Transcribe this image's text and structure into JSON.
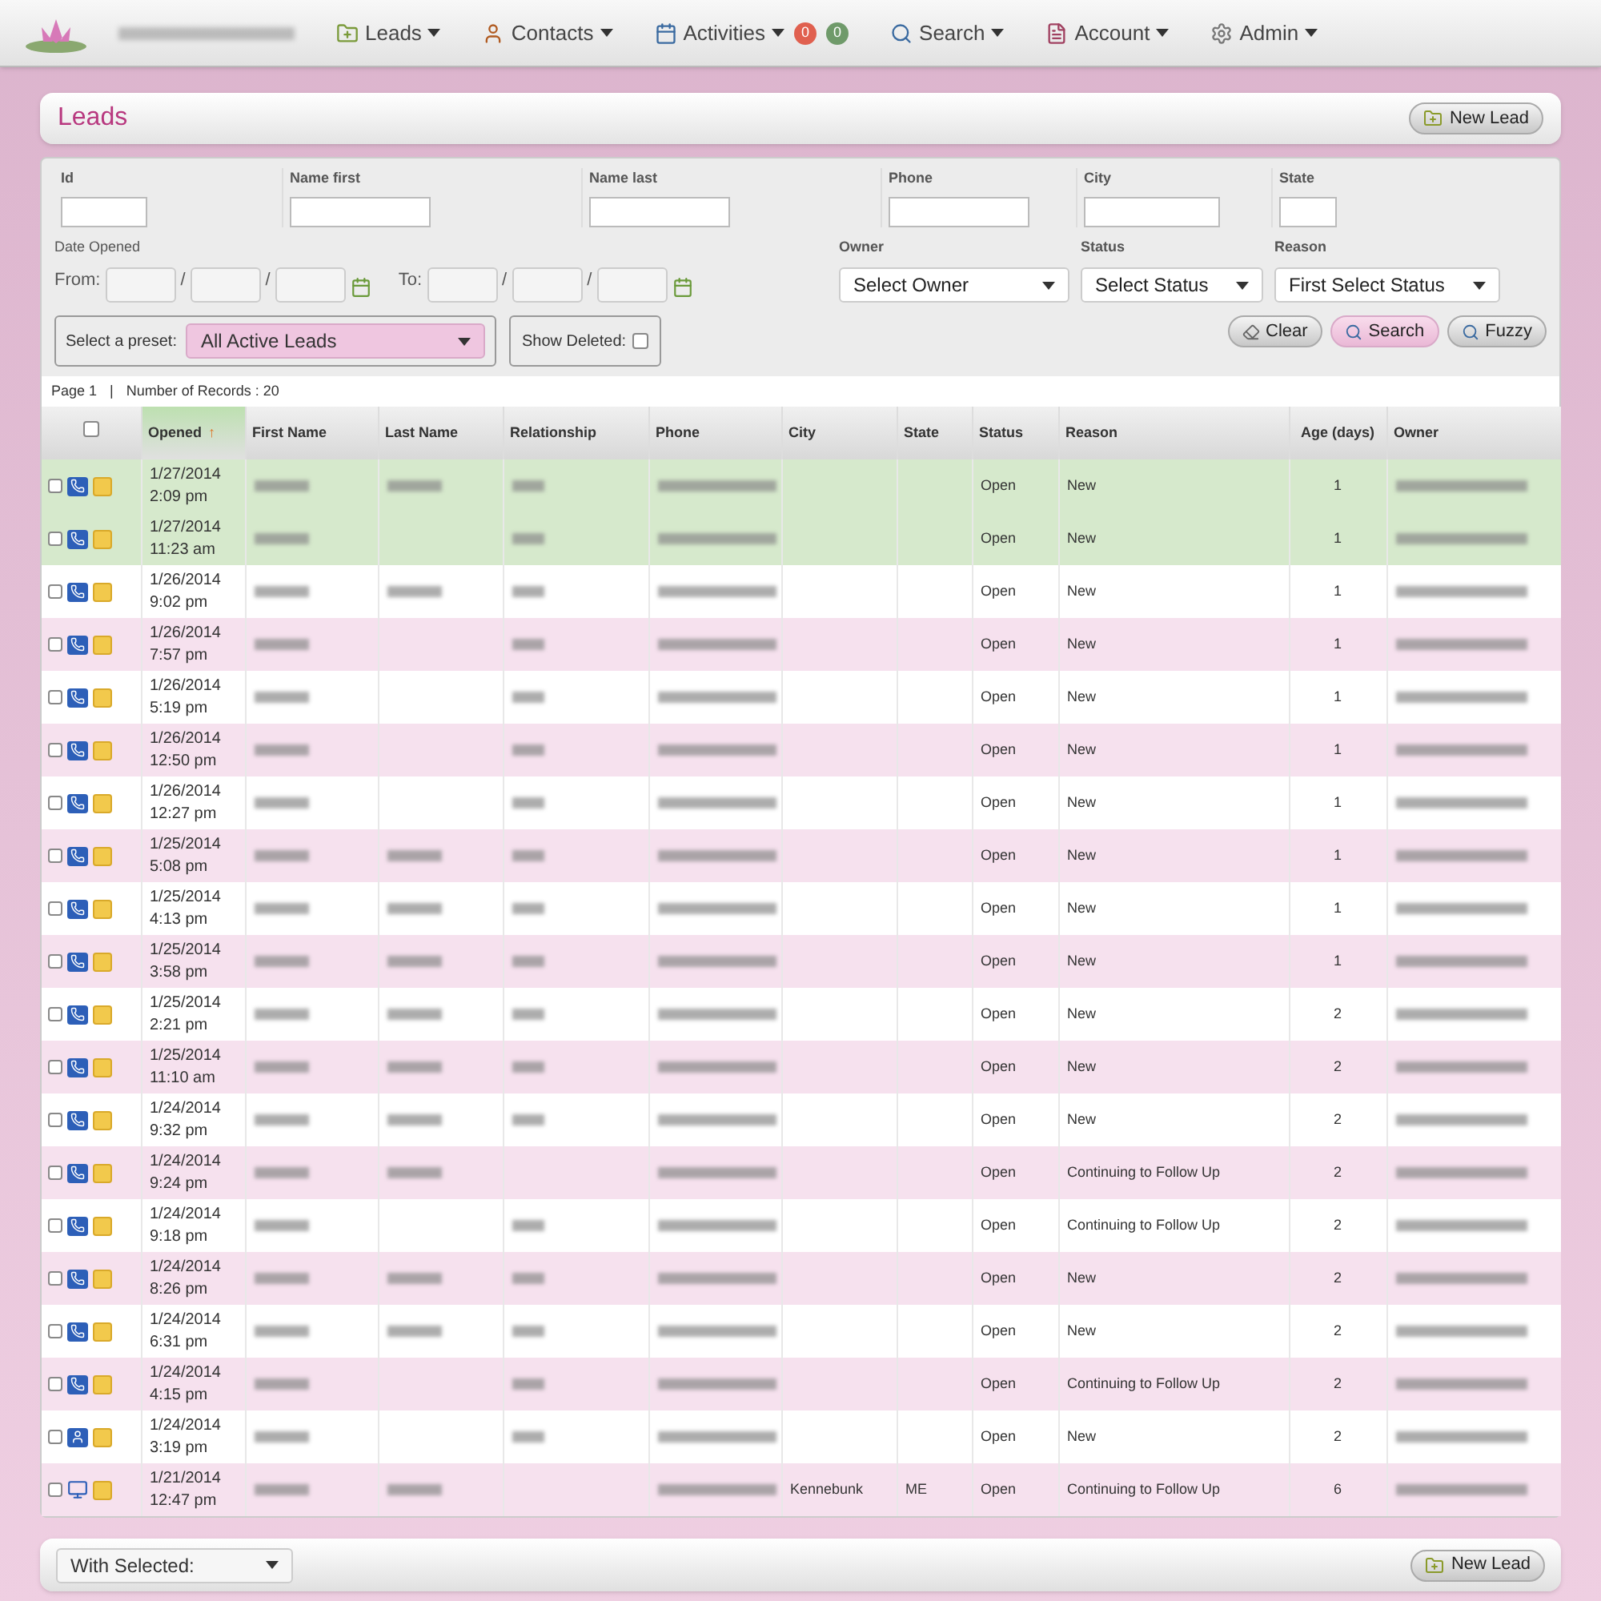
{
  "nav": {
    "items": [
      {
        "label": "Leads"
      },
      {
        "label": "Contacts"
      },
      {
        "label": "Activities",
        "badges": [
          {
            "text": "0",
            "color": "#e0604f"
          },
          {
            "text": "0",
            "color": "#6f9a6a"
          }
        ]
      },
      {
        "label": "Search"
      },
      {
        "label": "Account"
      },
      {
        "label": "Admin"
      }
    ]
  },
  "header": {
    "title": "Leads",
    "new_button": "New Lead"
  },
  "filters": {
    "fields": [
      {
        "label": "Id"
      },
      {
        "label": "Name first"
      },
      {
        "label": "Name last"
      },
      {
        "label": "Phone"
      },
      {
        "label": "City"
      },
      {
        "label": "State"
      }
    ],
    "date_label": "Date Opened",
    "from_label": "From:",
    "to_label": "To:",
    "separator": "/",
    "selects": [
      {
        "label": "Owner",
        "value": "Select Owner"
      },
      {
        "label": "Status",
        "value": "Select Status"
      },
      {
        "label": "Reason",
        "value": "First Select Status"
      }
    ],
    "preset_label": "Select a preset:",
    "preset_value": "All Active Leads",
    "show_deleted_label": "Show Deleted:",
    "show_deleted": false,
    "buttons": [
      {
        "label": "Clear",
        "selected": false
      },
      {
        "label": "Search",
        "selected": true
      },
      {
        "label": "Fuzzy",
        "selected": false
      }
    ]
  },
  "pager": {
    "page": "Page 1",
    "divider": "|",
    "records": "Number of Records : 20"
  },
  "table": {
    "select_all_checked": false,
    "columns": [
      {
        "label": "Opened",
        "sorted": true
      },
      {
        "label": "First Name",
        "sorted": false
      },
      {
        "label": "Last Name",
        "sorted": false
      },
      {
        "label": "Relationship",
        "sorted": false
      },
      {
        "label": "Phone",
        "sorted": false
      },
      {
        "label": "City",
        "sorted": false
      },
      {
        "label": "State",
        "sorted": false
      },
      {
        "label": "Status",
        "sorted": false
      },
      {
        "label": "Reason",
        "sorted": false
      },
      {
        "label": "Age (days)",
        "sorted": false
      },
      {
        "label": "Owner",
        "sorted": false
      }
    ],
    "sort_arrow": "↑",
    "rows": [
      {
        "highlighted": true,
        "checked": false,
        "kind": "phone",
        "cells": [
          {
            "kind": "datetime",
            "date": "1/27/2014",
            "time": "2:09 pm"
          },
          {
            "kind": "blurred"
          },
          {
            "kind": "blurred"
          },
          {
            "kind": "blurred"
          },
          {
            "kind": "blurred"
          },
          {
            "kind": "blank"
          },
          {
            "kind": "blank"
          },
          {
            "kind": "text",
            "text": "Open"
          },
          {
            "kind": "text",
            "text": "New"
          },
          {
            "kind": "text",
            "text": "1"
          },
          {
            "kind": "blurred"
          }
        ]
      },
      {
        "highlighted": true,
        "checked": false,
        "kind": "phone",
        "cells": [
          {
            "kind": "datetime",
            "date": "1/27/2014",
            "time": "11:23 am"
          },
          {
            "kind": "blurred"
          },
          {
            "kind": "blank"
          },
          {
            "kind": "blurred"
          },
          {
            "kind": "blurred"
          },
          {
            "kind": "blank"
          },
          {
            "kind": "blank"
          },
          {
            "kind": "text",
            "text": "Open"
          },
          {
            "kind": "text",
            "text": "New"
          },
          {
            "kind": "text",
            "text": "1"
          },
          {
            "kind": "blurred"
          }
        ]
      },
      {
        "highlighted": false,
        "checked": false,
        "kind": "phone",
        "cells": [
          {
            "kind": "datetime",
            "date": "1/26/2014",
            "time": "9:02 pm"
          },
          {
            "kind": "blurred"
          },
          {
            "kind": "blurred"
          },
          {
            "kind": "blurred"
          },
          {
            "kind": "blurred"
          },
          {
            "kind": "blank"
          },
          {
            "kind": "blank"
          },
          {
            "kind": "text",
            "text": "Open"
          },
          {
            "kind": "text",
            "text": "New"
          },
          {
            "kind": "text",
            "text": "1"
          },
          {
            "kind": "blurred"
          }
        ]
      },
      {
        "highlighted": false,
        "checked": false,
        "kind": "phone",
        "cells": [
          {
            "kind": "datetime",
            "date": "1/26/2014",
            "time": "7:57 pm"
          },
          {
            "kind": "blurred"
          },
          {
            "kind": "blank"
          },
          {
            "kind": "blurred"
          },
          {
            "kind": "blurred"
          },
          {
            "kind": "blank"
          },
          {
            "kind": "blank"
          },
          {
            "kind": "text",
            "text": "Open"
          },
          {
            "kind": "text",
            "text": "New"
          },
          {
            "kind": "text",
            "text": "1"
          },
          {
            "kind": "blurred"
          }
        ]
      },
      {
        "highlighted": false,
        "checked": false,
        "kind": "phone",
        "cells": [
          {
            "kind": "datetime",
            "date": "1/26/2014",
            "time": "5:19 pm"
          },
          {
            "kind": "blurred"
          },
          {
            "kind": "blank"
          },
          {
            "kind": "blurred"
          },
          {
            "kind": "blurred"
          },
          {
            "kind": "blank"
          },
          {
            "kind": "blank"
          },
          {
            "kind": "text",
            "text": "Open"
          },
          {
            "kind": "text",
            "text": "New"
          },
          {
            "kind": "text",
            "text": "1"
          },
          {
            "kind": "blurred"
          }
        ]
      },
      {
        "highlighted": false,
        "checked": false,
        "kind": "phone",
        "cells": [
          {
            "kind": "datetime",
            "date": "1/26/2014",
            "time": "12:50 pm"
          },
          {
            "kind": "blurred"
          },
          {
            "kind": "blank"
          },
          {
            "kind": "blurred"
          },
          {
            "kind": "blurred"
          },
          {
            "kind": "blank"
          },
          {
            "kind": "blank"
          },
          {
            "kind": "text",
            "text": "Open"
          },
          {
            "kind": "text",
            "text": "New"
          },
          {
            "kind": "text",
            "text": "1"
          },
          {
            "kind": "blurred"
          }
        ]
      },
      {
        "highlighted": false,
        "checked": false,
        "kind": "phone",
        "cells": [
          {
            "kind": "datetime",
            "date": "1/26/2014",
            "time": "12:27 pm"
          },
          {
            "kind": "blurred"
          },
          {
            "kind": "blank"
          },
          {
            "kind": "blurred"
          },
          {
            "kind": "blurred"
          },
          {
            "kind": "blank"
          },
          {
            "kind": "blank"
          },
          {
            "kind": "text",
            "text": "Open"
          },
          {
            "kind": "text",
            "text": "New"
          },
          {
            "kind": "text",
            "text": "1"
          },
          {
            "kind": "blurred"
          }
        ]
      },
      {
        "highlighted": false,
        "checked": false,
        "kind": "phone",
        "cells": [
          {
            "kind": "datetime",
            "date": "1/25/2014",
            "time": "5:08 pm"
          },
          {
            "kind": "blurred"
          },
          {
            "kind": "blurred"
          },
          {
            "kind": "blurred"
          },
          {
            "kind": "blurred"
          },
          {
            "kind": "blank"
          },
          {
            "kind": "blank"
          },
          {
            "kind": "text",
            "text": "Open"
          },
          {
            "kind": "text",
            "text": "New"
          },
          {
            "kind": "text",
            "text": "1"
          },
          {
            "kind": "blurred"
          }
        ]
      },
      {
        "highlighted": false,
        "checked": false,
        "kind": "phone",
        "cells": [
          {
            "kind": "datetime",
            "date": "1/25/2014",
            "time": "4:13 pm"
          },
          {
            "kind": "blurred"
          },
          {
            "kind": "blurred"
          },
          {
            "kind": "blurred"
          },
          {
            "kind": "blurred"
          },
          {
            "kind": "blank"
          },
          {
            "kind": "blank"
          },
          {
            "kind": "text",
            "text": "Open"
          },
          {
            "kind": "text",
            "text": "New"
          },
          {
            "kind": "text",
            "text": "1"
          },
          {
            "kind": "blurred"
          }
        ]
      },
      {
        "highlighted": false,
        "checked": false,
        "kind": "phone",
        "cells": [
          {
            "kind": "datetime",
            "date": "1/25/2014",
            "time": "3:58 pm"
          },
          {
            "kind": "blurred"
          },
          {
            "kind": "blurred"
          },
          {
            "kind": "blurred"
          },
          {
            "kind": "blurred"
          },
          {
            "kind": "blank"
          },
          {
            "kind": "blank"
          },
          {
            "kind": "text",
            "text": "Open"
          },
          {
            "kind": "text",
            "text": "New"
          },
          {
            "kind": "text",
            "text": "1"
          },
          {
            "kind": "blurred"
          }
        ]
      },
      {
        "highlighted": false,
        "checked": false,
        "kind": "phone",
        "cells": [
          {
            "kind": "datetime",
            "date": "1/25/2014",
            "time": "2:21 pm"
          },
          {
            "kind": "blurred"
          },
          {
            "kind": "blurred"
          },
          {
            "kind": "blurred"
          },
          {
            "kind": "blurred"
          },
          {
            "kind": "blank"
          },
          {
            "kind": "blank"
          },
          {
            "kind": "text",
            "text": "Open"
          },
          {
            "kind": "text",
            "text": "New"
          },
          {
            "kind": "text",
            "text": "2"
          },
          {
            "kind": "blurred"
          }
        ]
      },
      {
        "highlighted": false,
        "checked": false,
        "kind": "phone",
        "cells": [
          {
            "kind": "datetime",
            "date": "1/25/2014",
            "time": "11:10 am"
          },
          {
            "kind": "blurred"
          },
          {
            "kind": "blurred"
          },
          {
            "kind": "blurred"
          },
          {
            "kind": "blurred"
          },
          {
            "kind": "blank"
          },
          {
            "kind": "blank"
          },
          {
            "kind": "text",
            "text": "Open"
          },
          {
            "kind": "text",
            "text": "New"
          },
          {
            "kind": "text",
            "text": "2"
          },
          {
            "kind": "blurred"
          }
        ]
      },
      {
        "highlighted": false,
        "checked": false,
        "kind": "phone",
        "cells": [
          {
            "kind": "datetime",
            "date": "1/24/2014",
            "time": "9:32 pm"
          },
          {
            "kind": "blurred"
          },
          {
            "kind": "blurred"
          },
          {
            "kind": "blurred"
          },
          {
            "kind": "blurred"
          },
          {
            "kind": "blank"
          },
          {
            "kind": "blank"
          },
          {
            "kind": "text",
            "text": "Open"
          },
          {
            "kind": "text",
            "text": "New"
          },
          {
            "kind": "text",
            "text": "2"
          },
          {
            "kind": "blurred"
          }
        ]
      },
      {
        "highlighted": false,
        "checked": false,
        "kind": "phone",
        "cells": [
          {
            "kind": "datetime",
            "date": "1/24/2014",
            "time": "9:24 pm"
          },
          {
            "kind": "blurred"
          },
          {
            "kind": "blurred"
          },
          {
            "kind": "blank"
          },
          {
            "kind": "blurred"
          },
          {
            "kind": "blank"
          },
          {
            "kind": "blank"
          },
          {
            "kind": "text",
            "text": "Open"
          },
          {
            "kind": "text",
            "text": "Continuing to Follow Up"
          },
          {
            "kind": "text",
            "text": "2"
          },
          {
            "kind": "blurred"
          }
        ]
      },
      {
        "highlighted": false,
        "checked": false,
        "kind": "phone",
        "cells": [
          {
            "kind": "datetime",
            "date": "1/24/2014",
            "time": "9:18 pm"
          },
          {
            "kind": "blurred"
          },
          {
            "kind": "blank"
          },
          {
            "kind": "blurred"
          },
          {
            "kind": "blurred"
          },
          {
            "kind": "blank"
          },
          {
            "kind": "blank"
          },
          {
            "kind": "text",
            "text": "Open"
          },
          {
            "kind": "text",
            "text": "Continuing to Follow Up"
          },
          {
            "kind": "text",
            "text": "2"
          },
          {
            "kind": "blurred"
          }
        ]
      },
      {
        "highlighted": false,
        "checked": false,
        "kind": "phone",
        "cells": [
          {
            "kind": "datetime",
            "date": "1/24/2014",
            "time": "8:26 pm"
          },
          {
            "kind": "blurred"
          },
          {
            "kind": "blurred"
          },
          {
            "kind": "blurred"
          },
          {
            "kind": "blurred"
          },
          {
            "kind": "blank"
          },
          {
            "kind": "blank"
          },
          {
            "kind": "text",
            "text": "Open"
          },
          {
            "kind": "text",
            "text": "New"
          },
          {
            "kind": "text",
            "text": "2"
          },
          {
            "kind": "blurred"
          }
        ]
      },
      {
        "highlighted": false,
        "checked": false,
        "kind": "phone",
        "cells": [
          {
            "kind": "datetime",
            "date": "1/24/2014",
            "time": "6:31 pm"
          },
          {
            "kind": "blurred"
          },
          {
            "kind": "blurred"
          },
          {
            "kind": "blurred"
          },
          {
            "kind": "blurred"
          },
          {
            "kind": "blank"
          },
          {
            "kind": "blank"
          },
          {
            "kind": "text",
            "text": "Open"
          },
          {
            "kind": "text",
            "text": "New"
          },
          {
            "kind": "text",
            "text": "2"
          },
          {
            "kind": "blurred"
          }
        ]
      },
      {
        "highlighted": false,
        "checked": false,
        "kind": "phone",
        "cells": [
          {
            "kind": "datetime",
            "date": "1/24/2014",
            "time": "4:15 pm"
          },
          {
            "kind": "blurred"
          },
          {
            "kind": "blank"
          },
          {
            "kind": "blurred"
          },
          {
            "kind": "blurred"
          },
          {
            "kind": "blank"
          },
          {
            "kind": "blank"
          },
          {
            "kind": "text",
            "text": "Open"
          },
          {
            "kind": "text",
            "text": "Continuing to Follow Up"
          },
          {
            "kind": "text",
            "text": "2"
          },
          {
            "kind": "blurred"
          }
        ]
      },
      {
        "highlighted": false,
        "checked": false,
        "kind": "person",
        "cells": [
          {
            "kind": "datetime",
            "date": "1/24/2014",
            "time": "3:19 pm"
          },
          {
            "kind": "blurred"
          },
          {
            "kind": "blank"
          },
          {
            "kind": "blurred"
          },
          {
            "kind": "blurred"
          },
          {
            "kind": "blank"
          },
          {
            "kind": "blank"
          },
          {
            "kind": "text",
            "text": "Open"
          },
          {
            "kind": "text",
            "text": "New"
          },
          {
            "kind": "text",
            "text": "2"
          },
          {
            "kind": "blurred"
          }
        ]
      },
      {
        "highlighted": false,
        "checked": false,
        "kind": "computer",
        "cells": [
          {
            "kind": "datetime",
            "date": "1/21/2014",
            "time": "12:47 pm"
          },
          {
            "kind": "blurred"
          },
          {
            "kind": "blurred"
          },
          {
            "kind": "blank"
          },
          {
            "kind": "blurred"
          },
          {
            "kind": "text",
            "text": "Kennebunk"
          },
          {
            "kind": "text",
            "text": "ME"
          },
          {
            "kind": "text",
            "text": "Open"
          },
          {
            "kind": "text",
            "text": "Continuing to Follow Up"
          },
          {
            "kind": "text",
            "text": "6"
          },
          {
            "kind": "blurred"
          }
        ]
      }
    ]
  },
  "footer": {
    "with_selected": "With Selected:",
    "new_button": "New Lead"
  }
}
